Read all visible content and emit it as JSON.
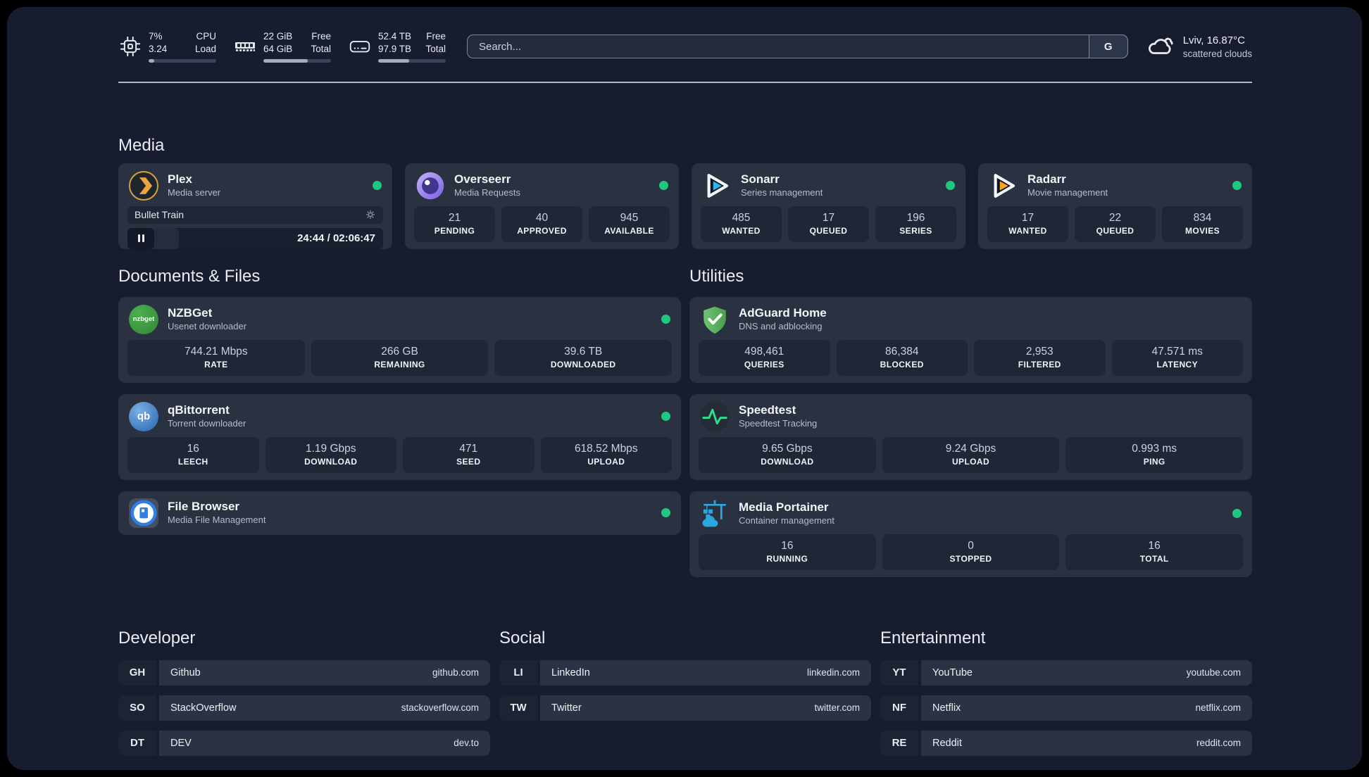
{
  "header": {
    "system_stats": [
      {
        "id": "cpu",
        "value_top": "7%",
        "value_bottom": "3.24",
        "label_top": "CPU",
        "label_bottom": "Load",
        "progress_pct": 8
      },
      {
        "id": "memory",
        "value_top": "22 GiB",
        "value_bottom": "64 GiB",
        "label_top": "Free",
        "label_bottom": "Total",
        "progress_pct": 66
      },
      {
        "id": "disk",
        "value_top": "52.4 TB",
        "value_bottom": "97.9 TB",
        "label_top": "Free",
        "label_bottom": "Total",
        "progress_pct": 46
      }
    ],
    "search": {
      "placeholder": "Search...",
      "button_label": "G"
    },
    "weather": {
      "location": "Lviv, 16.87°C",
      "condition": "scattered clouds"
    }
  },
  "media_section": {
    "title": "Media",
    "plex": {
      "name": "Plex",
      "subtitle": "Media server",
      "now_playing": "Bullet Train",
      "time_display": "24:44 / 02:06:47",
      "progress_pct": 20
    },
    "overseerr": {
      "name": "Overseerr",
      "subtitle": "Media Requests",
      "stats": [
        {
          "value": "21",
          "label": "PENDING"
        },
        {
          "value": "40",
          "label": "APPROVED"
        },
        {
          "value": "945",
          "label": "AVAILABLE"
        }
      ]
    },
    "sonarr": {
      "name": "Sonarr",
      "subtitle": "Series management",
      "stats": [
        {
          "value": "485",
          "label": "WANTED"
        },
        {
          "value": "17",
          "label": "QUEUED"
        },
        {
          "value": "196",
          "label": "SERIES"
        }
      ]
    },
    "radarr": {
      "name": "Radarr",
      "subtitle": "Movie management",
      "stats": [
        {
          "value": "17",
          "label": "WANTED"
        },
        {
          "value": "22",
          "label": "QUEUED"
        },
        {
          "value": "834",
          "label": "MOVIES"
        }
      ]
    }
  },
  "documents_section": {
    "title": "Documents & Files",
    "nzbget": {
      "name": "NZBGet",
      "subtitle": "Usenet downloader",
      "icon_text": "nzbget",
      "stats": [
        {
          "value": "744.21 Mbps",
          "label": "RATE"
        },
        {
          "value": "266 GB",
          "label": "REMAINING"
        },
        {
          "value": "39.6 TB",
          "label": "DOWNLOADED"
        }
      ]
    },
    "qbittorrent": {
      "name": "qBittorrent",
      "subtitle": "Torrent downloader",
      "icon_text": "qb",
      "stats": [
        {
          "value": "16",
          "label": "LEECH"
        },
        {
          "value": "1.19 Gbps",
          "label": "DOWNLOAD"
        },
        {
          "value": "471",
          "label": "SEED"
        },
        {
          "value": "618.52 Mbps",
          "label": "UPLOAD"
        }
      ]
    },
    "filebrowser": {
      "name": "File Browser",
      "subtitle": "Media File Management"
    }
  },
  "utilities_section": {
    "title": "Utilities",
    "adguard": {
      "name": "AdGuard Home",
      "subtitle": "DNS and adblocking",
      "stats": [
        {
          "value": "498,461",
          "label": "QUERIES"
        },
        {
          "value": "86,384",
          "label": "BLOCKED"
        },
        {
          "value": "2,953",
          "label": "FILTERED"
        },
        {
          "value": "47.571 ms",
          "label": "LATENCY"
        }
      ]
    },
    "speedtest": {
      "name": "Speedtest",
      "subtitle": "Speedtest Tracking",
      "stats": [
        {
          "value": "9.65 Gbps",
          "label": "DOWNLOAD"
        },
        {
          "value": "9.24 Gbps",
          "label": "UPLOAD"
        },
        {
          "value": "0.993 ms",
          "label": "PING"
        }
      ]
    },
    "portainer": {
      "name": "Media Portainer",
      "subtitle": "Container management",
      "stats": [
        {
          "value": "16",
          "label": "RUNNING"
        },
        {
          "value": "0",
          "label": "STOPPED"
        },
        {
          "value": "16",
          "label": "TOTAL"
        }
      ]
    }
  },
  "link_sections": [
    {
      "title": "Developer",
      "links": [
        {
          "abbr": "GH",
          "name": "Github",
          "url": "github.com"
        },
        {
          "abbr": "SO",
          "name": "StackOverflow",
          "url": "stackoverflow.com"
        },
        {
          "abbr": "DT",
          "name": "DEV",
          "url": "dev.to"
        }
      ]
    },
    {
      "title": "Social",
      "links": [
        {
          "abbr": "LI",
          "name": "LinkedIn",
          "url": "linkedin.com"
        },
        {
          "abbr": "TW",
          "name": "Twitter",
          "url": "twitter.com"
        }
      ]
    },
    {
      "title": "Entertainment",
      "links": [
        {
          "abbr": "YT",
          "name": "YouTube",
          "url": "youtube.com"
        },
        {
          "abbr": "NF",
          "name": "Netflix",
          "url": "netflix.com"
        },
        {
          "abbr": "RE",
          "name": "Reddit",
          "url": "reddit.com"
        }
      ]
    }
  ],
  "icons": {
    "system": [
      "cpu-icon",
      "memory-icon",
      "disk-icon"
    ],
    "weather": "cloud-icon",
    "plex_player": [
      "gear-icon",
      "pause-icon"
    ]
  },
  "colors": {
    "status_ok": "#1fc87e",
    "plex_accent": "#eba53c",
    "sonarr_accent": "#29b7ec",
    "radarr_accent": "#f6a722",
    "nzbget_green": "#3f9e41",
    "qbittorrent_blue": "#4a86c8",
    "adguard_green": "#5cb85f",
    "speedtest_green": "#2ede8a",
    "portainer_blue": "#2ba7df",
    "filebrowser_blue": "#2f80e4"
  }
}
